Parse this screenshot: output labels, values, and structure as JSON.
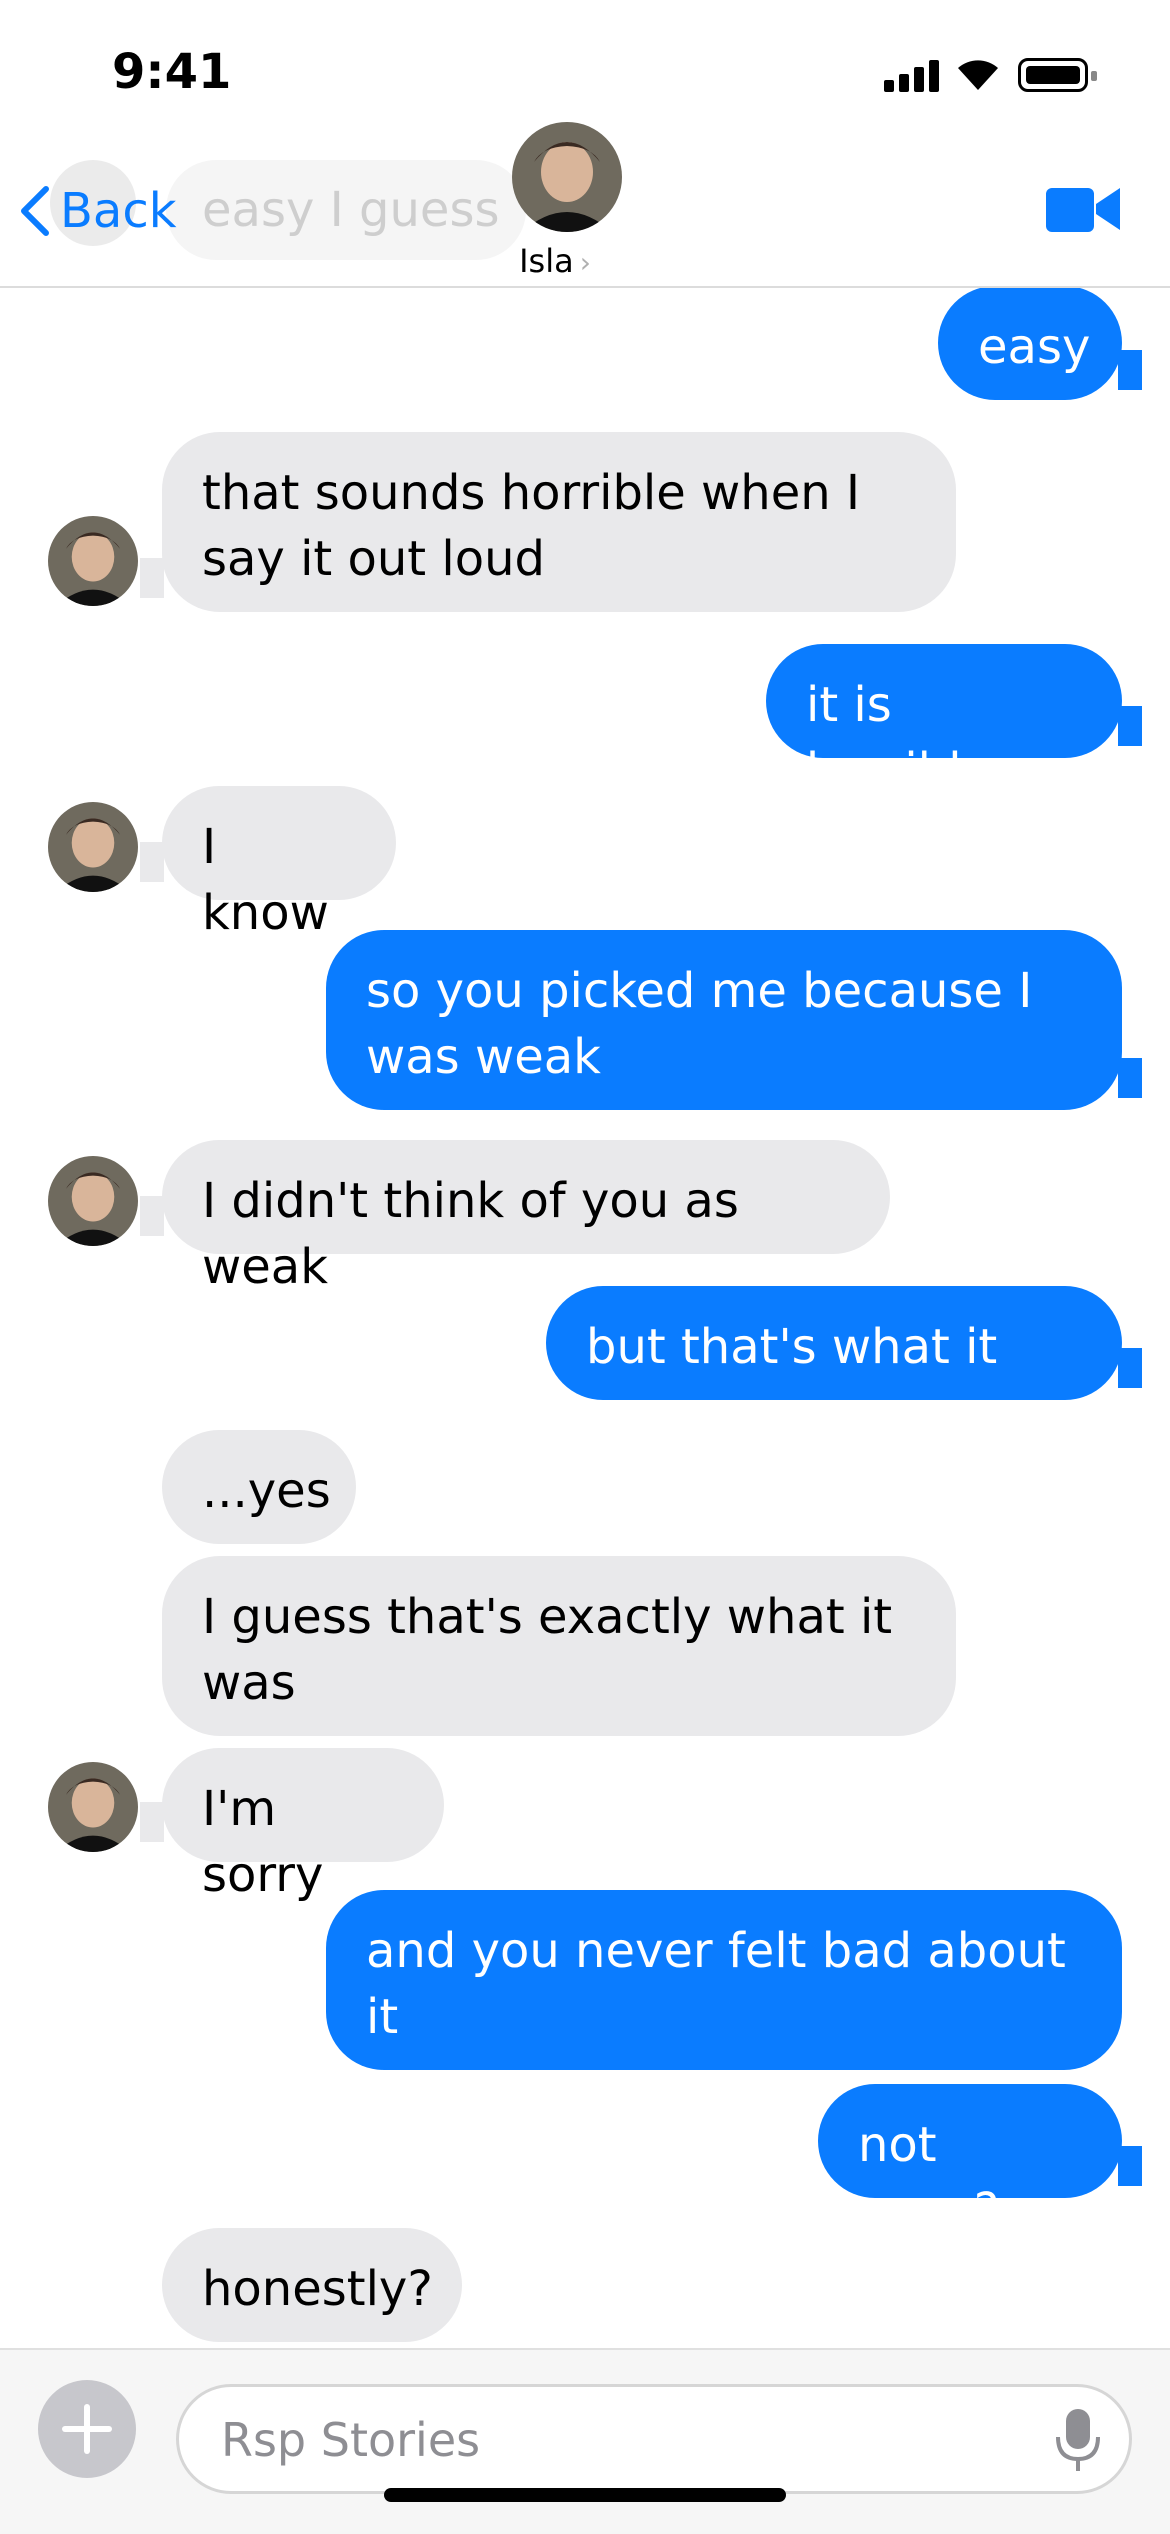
{
  "status_bar": {
    "time": "9:41"
  },
  "header": {
    "back_label": "Back",
    "ghost_preview": "easy I guess",
    "contact_name": "Isla",
    "accent": "#0a7cff"
  },
  "messages": [
    {
      "dir": "out",
      "text": "easy"
    },
    {
      "dir": "in",
      "text": "that sounds horrible when I say it out loud"
    },
    {
      "dir": "out",
      "text": "it is horrible"
    },
    {
      "dir": "in",
      "text": "I know"
    },
    {
      "dir": "out",
      "text": "so you picked me because I was weak"
    },
    {
      "dir": "in",
      "text": "I didn't think of you as weak"
    },
    {
      "dir": "out",
      "text": "but that's what it was"
    },
    {
      "dir": "in",
      "text": "...yes"
    },
    {
      "dir": "in",
      "text": "I guess that's exactly what it was"
    },
    {
      "dir": "in",
      "text": "I'm sorry"
    },
    {
      "dir": "out",
      "text": "and you never felt bad about it"
    },
    {
      "dir": "out",
      "text": "not once?"
    },
    {
      "dir": "in",
      "text": "honestly?"
    }
  ],
  "input": {
    "placeholder": "Rsp Stories"
  },
  "icons": {
    "back": "chevron-left-icon",
    "video": "video-camera-icon",
    "plus": "plus-icon",
    "mic": "microphone-icon"
  },
  "colors": {
    "outgoing": "#0a7cff",
    "incoming": "#e9e9eb"
  }
}
